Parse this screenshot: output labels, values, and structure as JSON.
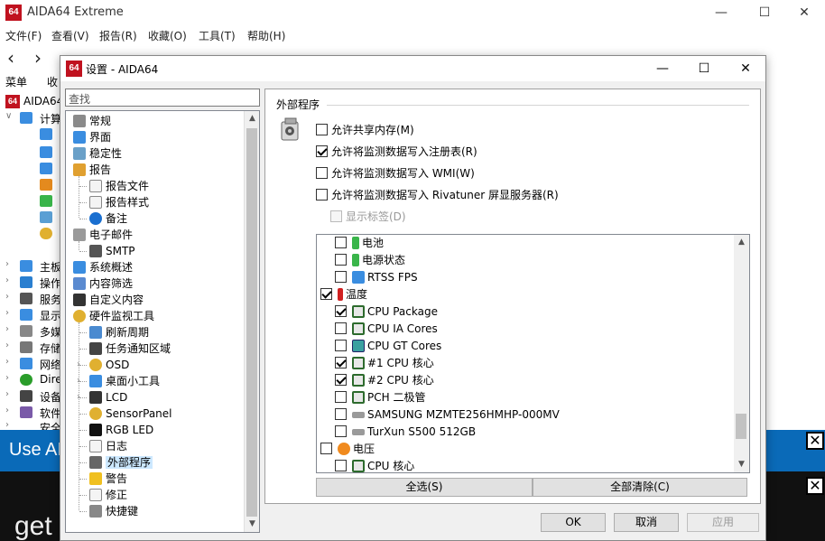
{
  "main": {
    "title": "AIDA64 Extreme",
    "logo": "64",
    "menu": [
      "文件(F)",
      "查看(V)",
      "报告(R)",
      "收藏(O)",
      "工具(T)",
      "帮助(H)"
    ],
    "left_tab": "菜单",
    "left_tab2": "收",
    "tree_root": "AIDA64",
    "tree_computer": "计算",
    "left_items": [
      "主板",
      "操作",
      "服务",
      "显示",
      "多媒",
      "存储",
      "网络",
      "Direc",
      "设备",
      "软件",
      "安全"
    ],
    "banner_text": "Use AI",
    "get_text": "get"
  },
  "dialog": {
    "title": "设置 - AIDA64",
    "logo": "64",
    "search_placeholder": "查找",
    "tree": [
      {
        "label": "常规",
        "icon": "gear-icon"
      },
      {
        "label": "界面",
        "icon": "monitor-icon"
      },
      {
        "label": "稳定性",
        "icon": "stability-icon"
      },
      {
        "label": "报告",
        "icon": "report-icon"
      },
      {
        "label": "报告文件",
        "icon": "document-icon"
      },
      {
        "label": "报告样式",
        "icon": "document-icon"
      },
      {
        "label": "备注",
        "icon": "info-icon"
      },
      {
        "label": "电子邮件",
        "icon": "email-icon"
      },
      {
        "label": "SMTP",
        "icon": "server-icon"
      },
      {
        "label": "系统概述",
        "icon": "monitor-icon"
      },
      {
        "label": "内容筛选",
        "icon": "filter-icon"
      },
      {
        "label": "自定义内容",
        "icon": "custom-icon"
      },
      {
        "label": "硬件监视工具",
        "icon": "gauge-icon"
      },
      {
        "label": "刷新周期",
        "icon": "refresh-icon"
      },
      {
        "label": "任务通知区域",
        "icon": "tray-icon"
      },
      {
        "label": "OSD",
        "icon": "gauge-icon"
      },
      {
        "label": "桌面小工具",
        "icon": "gadget-icon"
      },
      {
        "label": "LCD",
        "icon": "lcd-icon"
      },
      {
        "label": "SensorPanel",
        "icon": "gauge-icon"
      },
      {
        "label": "RGB LED",
        "icon": "rgb-icon"
      },
      {
        "label": "日志",
        "icon": "document-icon"
      },
      {
        "label": "外部程序",
        "icon": "external-program-icon"
      },
      {
        "label": "警告",
        "icon": "warning-icon"
      },
      {
        "label": "修正",
        "icon": "document-icon"
      },
      {
        "label": "快捷键",
        "icon": "keyboard-icon"
      }
    ],
    "section_title": "外部程序",
    "options": [
      {
        "label": "允许共享内存(M)",
        "checked": false,
        "disabled": false
      },
      {
        "label": "允许将监测数据写入注册表(R)",
        "checked": true,
        "disabled": false
      },
      {
        "label": "允许将监测数据写入 WMI(W)",
        "checked": false,
        "disabled": false
      },
      {
        "label": "允许将监测数据写入 Rivatuner 屏显服务器(R)",
        "checked": false,
        "disabled": false
      },
      {
        "label": "显示标签(D)",
        "checked": false,
        "disabled": true
      }
    ],
    "sensors": [
      {
        "label": "电池",
        "checked": false,
        "icon": "battery-icon",
        "level": 1
      },
      {
        "label": "电源状态",
        "checked": false,
        "icon": "battery-icon",
        "level": 1
      },
      {
        "label": "RTSS FPS",
        "checked": false,
        "icon": "monitor-icon",
        "level": 1
      },
      {
        "label": "温度",
        "checked": true,
        "icon": "thermometer-icon",
        "level": 0
      },
      {
        "label": "CPU Package",
        "checked": true,
        "icon": "chip-icon",
        "level": 1
      },
      {
        "label": "CPU IA Cores",
        "checked": false,
        "icon": "chip-icon",
        "level": 1
      },
      {
        "label": "CPU GT Cores",
        "checked": false,
        "icon": "gpu-icon",
        "level": 1
      },
      {
        "label": "#1 CPU 核心",
        "checked": true,
        "icon": "chip-icon",
        "level": 1
      },
      {
        "label": "#2 CPU 核心",
        "checked": true,
        "icon": "chip-icon",
        "level": 1
      },
      {
        "label": "PCH 二极管",
        "checked": false,
        "icon": "chip-icon",
        "level": 1
      },
      {
        "label": "SAMSUNG MZMTE256HMHP-000MV",
        "checked": false,
        "icon": "disk-icon",
        "level": 1
      },
      {
        "label": "TurXun S500 512GB",
        "checked": false,
        "icon": "disk-icon",
        "level": 1
      },
      {
        "label": "电压",
        "checked": false,
        "icon": "voltage-icon",
        "level": 0
      },
      {
        "label": "CPU 核心",
        "checked": false,
        "icon": "chip-icon",
        "level": 1
      }
    ],
    "select_all": "全选(S)",
    "clear_all": "全部清除(C)",
    "ok": "OK",
    "cancel": "取消",
    "apply": "应用"
  },
  "colors": {
    "accent_blue": "#0a6ab8",
    "logo_red": "#c0121f",
    "selected_bg": "#cce8ff"
  }
}
